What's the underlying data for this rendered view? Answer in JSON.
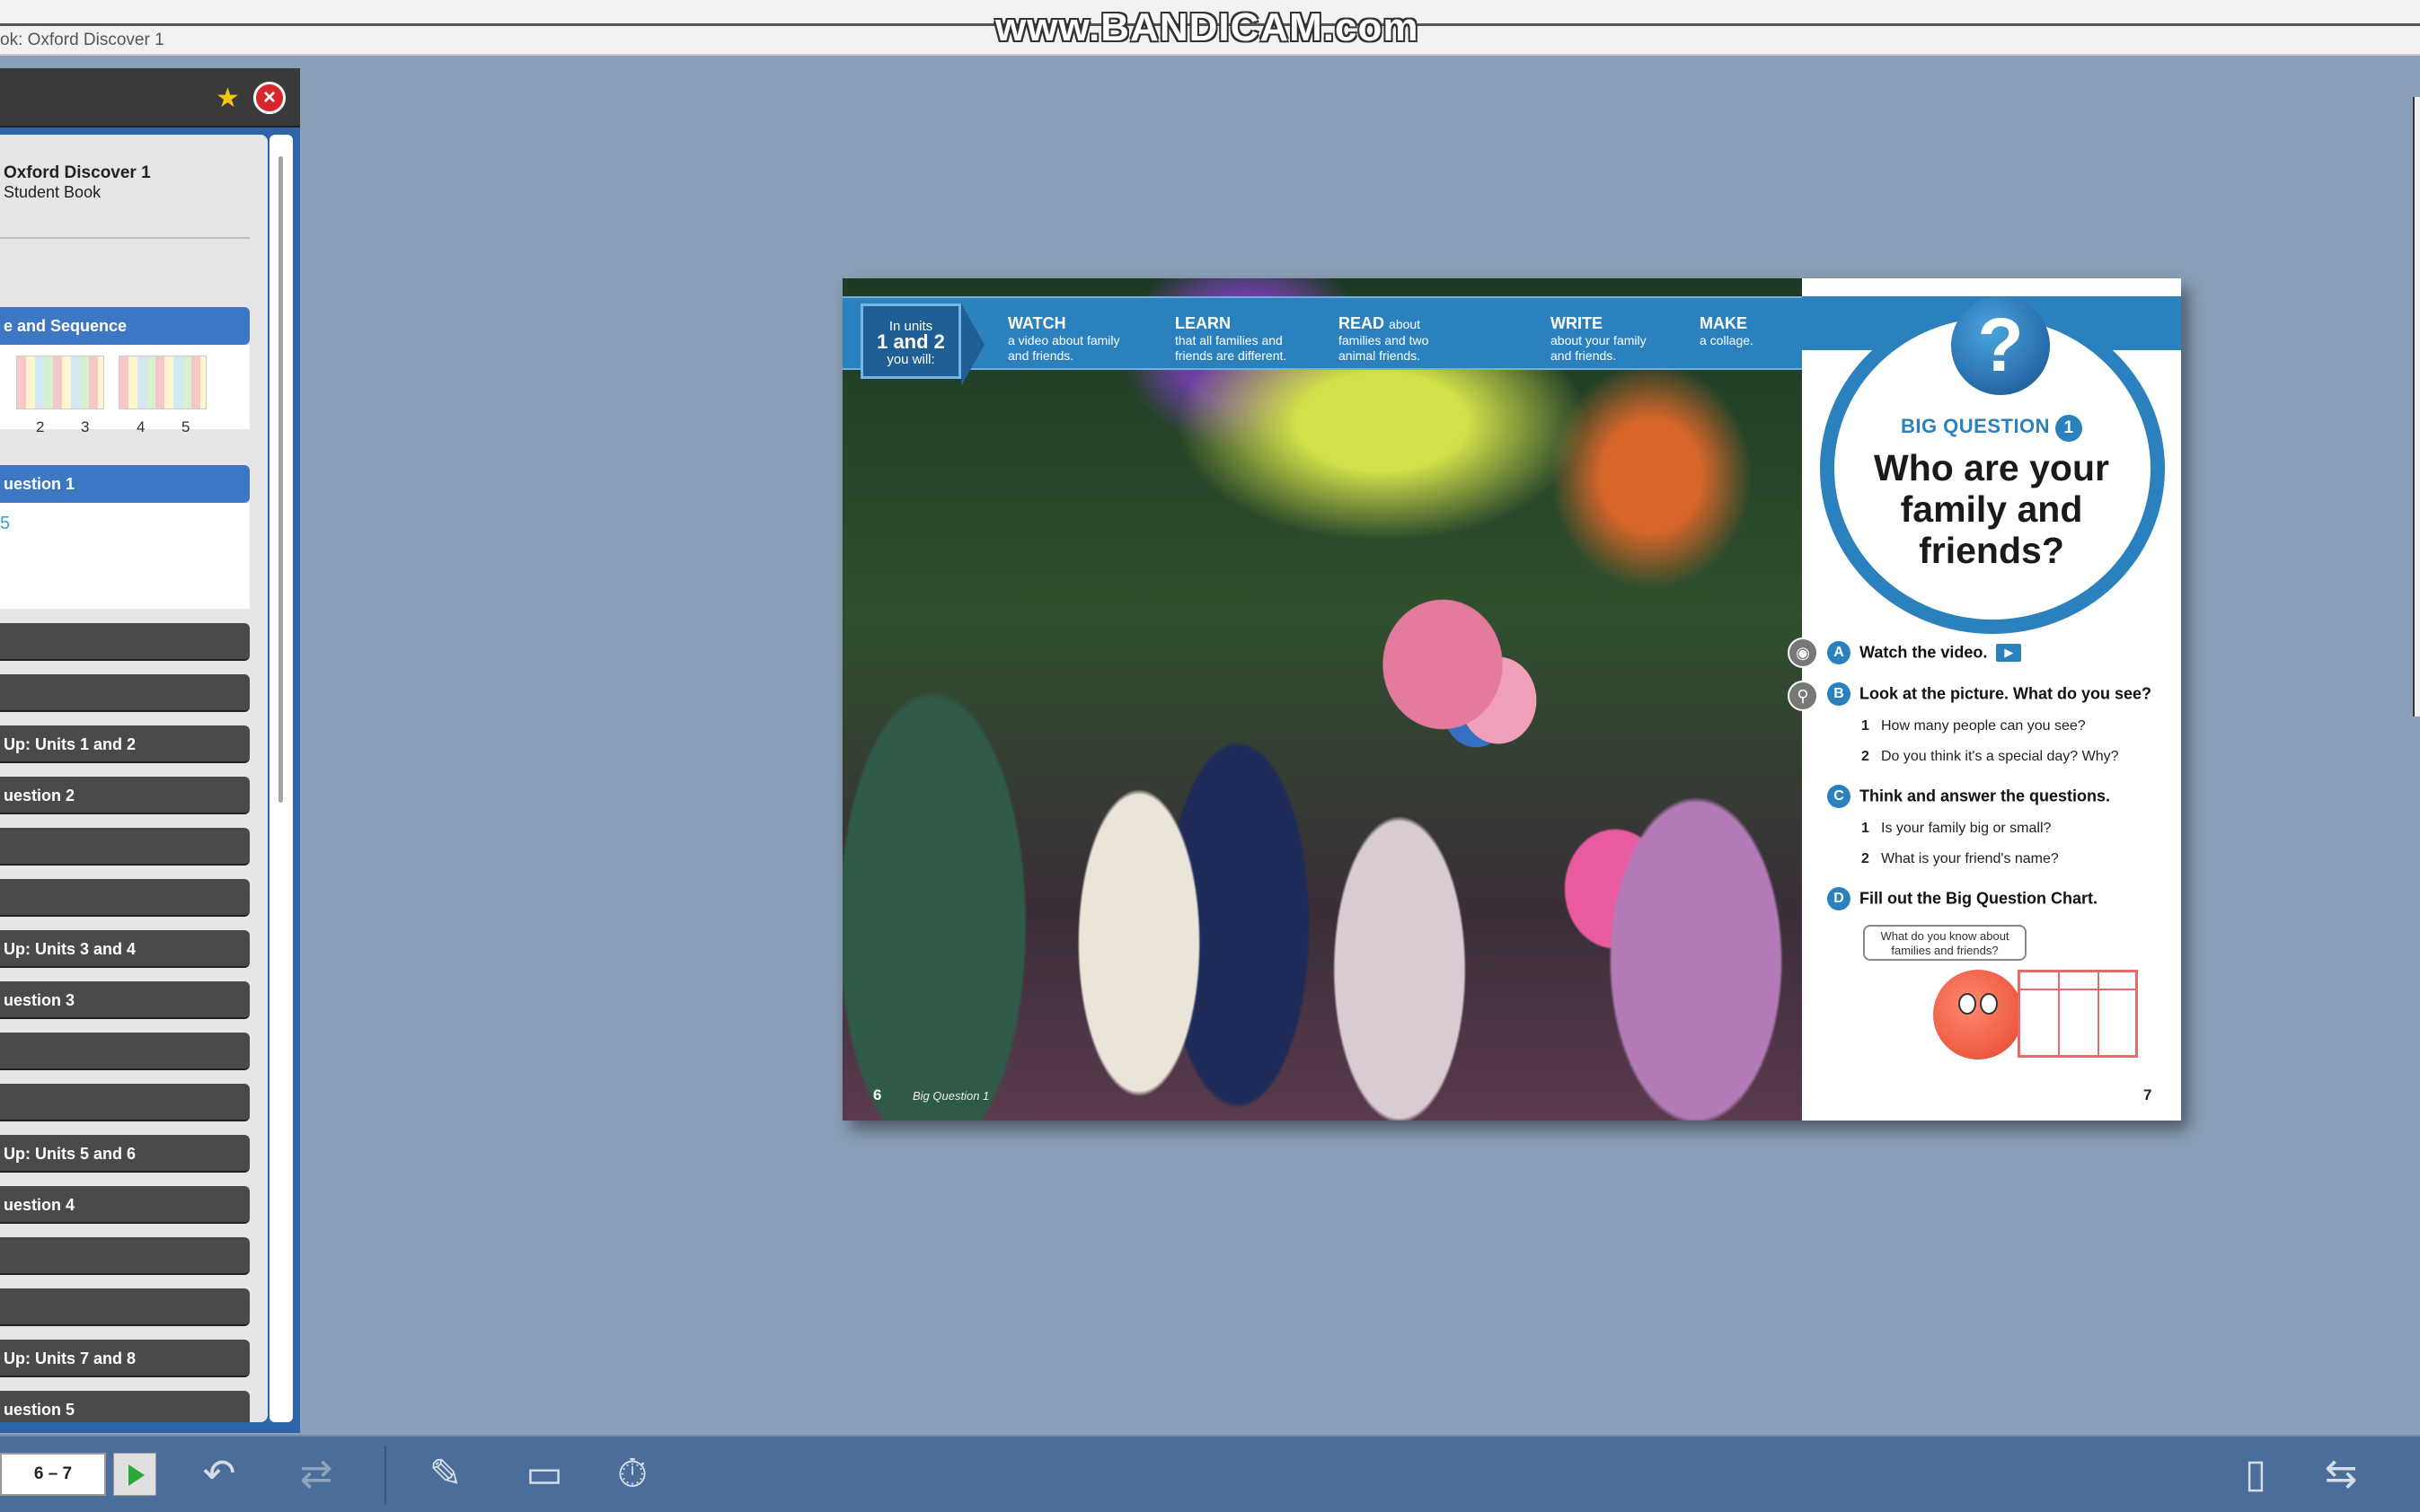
{
  "window": {
    "title": "ok: Oxford Discover 1",
    "watermark": "www.BANDICAM.com"
  },
  "sidebar": {
    "book_title": "Oxford Discover 1",
    "book_subtitle": "Student Book",
    "scope_label": "e and Sequence",
    "scope_thumb_numbers": [
      "2",
      "3",
      "4",
      "5"
    ],
    "question1_label": "uestion 1",
    "question1_mark": "5",
    "items": [
      {
        "label": ""
      },
      {
        "label": ""
      },
      {
        "label": "Up: Units 1 and 2"
      },
      {
        "label": "uestion 2"
      },
      {
        "label": ""
      },
      {
        "label": ""
      },
      {
        "label": "Up: Units 3 and 4"
      },
      {
        "label": "uestion 3"
      },
      {
        "label": ""
      },
      {
        "label": ""
      },
      {
        "label": "Up: Units 5 and 6"
      },
      {
        "label": "uestion 4"
      },
      {
        "label": ""
      },
      {
        "label": ""
      },
      {
        "label": "Up: Units 7 and 8"
      },
      {
        "label": "uestion 5"
      },
      {
        "label": ""
      }
    ]
  },
  "spread": {
    "banner": {
      "intro_line1": "In units",
      "intro_line2": "1 and 2",
      "intro_line3": "you will:",
      "columns": [
        {
          "verb": "WATCH",
          "verb_suffix": "",
          "desc1": "a video about family",
          "desc2": "and friends."
        },
        {
          "verb": "LEARN",
          "verb_suffix": "",
          "desc1": "that all families and",
          "desc2": "friends are different."
        },
        {
          "verb": "READ",
          "verb_suffix": "about",
          "desc1": "families and two",
          "desc2": "animal friends."
        },
        {
          "verb": "WRITE",
          "verb_suffix": "",
          "desc1": "about your family",
          "desc2": "and friends."
        },
        {
          "verb": "MAKE",
          "verb_suffix": "",
          "desc1": "a collage.",
          "desc2": ""
        }
      ]
    },
    "left_page_number": "6",
    "left_page_label": "Big Question 1",
    "right_page_number": "7",
    "big_question_label": "BIG QUESTION",
    "big_question_number": "1",
    "big_question_text": "Who are your family and friends?",
    "activities": {
      "a": {
        "letter": "A",
        "text": "Watch the video."
      },
      "b": {
        "letter": "B",
        "text": "Look at the picture. What do you see?",
        "subs": [
          {
            "n": "1",
            "text": "How many people can you see?"
          },
          {
            "n": "2",
            "text": "Do you think it's a special day? Why?"
          }
        ]
      },
      "c": {
        "letter": "C",
        "text": "Think and answer the questions.",
        "subs": [
          {
            "n": "1",
            "text": "Is your family big or small?"
          },
          {
            "n": "2",
            "text": "What is your friend's name?"
          }
        ]
      },
      "d": {
        "letter": "D",
        "text_prefix": "Fill out the",
        "text_bold": "Big Question Chart."
      }
    },
    "speech_bubble": "What do you know about families and friends?"
  },
  "toolbar": {
    "page_range": "6 – 7"
  }
}
